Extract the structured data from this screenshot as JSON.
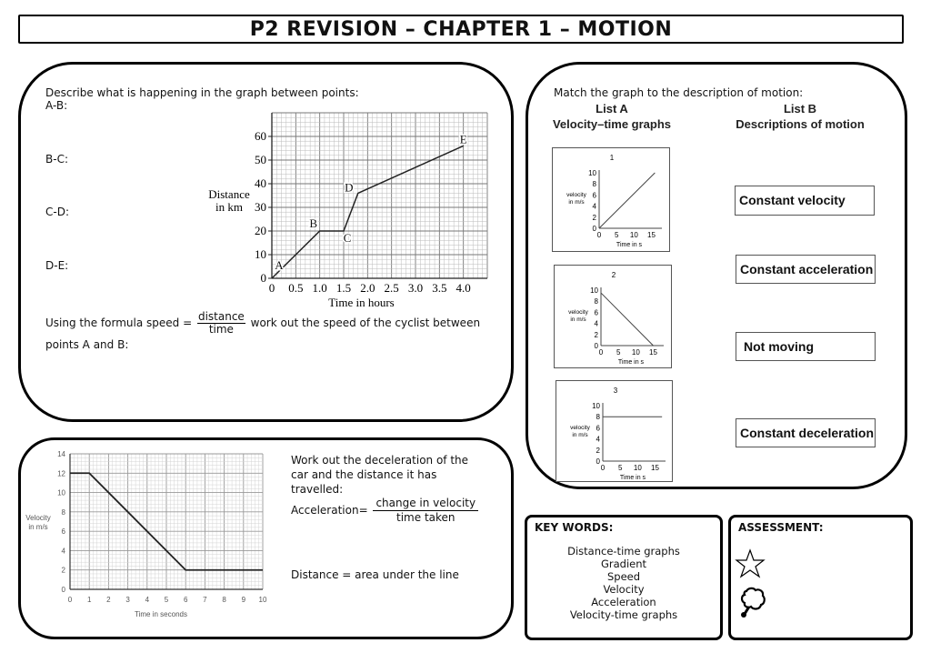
{
  "title": "P2 REVISION – CHAPTER 1 – MOTION",
  "distance_time_panel": {
    "prompt": "Describe what is happening in the graph between points:",
    "segments": [
      "A-B:",
      "B-C:",
      "C-D:",
      "D-E:"
    ],
    "formula_prefix": "Using the formula speed =",
    "formula_numerator": "distance",
    "formula_denominator": "time",
    "formula_suffix": "work out the speed of the cyclist between",
    "formula_line2": "points A and B:"
  },
  "match_panel": {
    "prompt": "Match the graph to the description of motion:",
    "list_a_title": "List A",
    "list_a_subtitle": "Velocity–time graphs",
    "list_b_title": "List B",
    "list_b_subtitle": "Descriptions of motion",
    "graphs": [
      {
        "number": "1",
        "ylabel_line1": "velocity",
        "ylabel_line2": "in m/s",
        "xlabel": "Time in s",
        "yticks": [
          "10",
          "8",
          "6",
          "4",
          "2",
          "0"
        ],
        "xticks": [
          "0",
          "5",
          "10",
          "15"
        ],
        "points": [
          [
            0,
            0
          ],
          [
            16,
            10
          ]
        ]
      },
      {
        "number": "2",
        "ylabel_line1": "velocity",
        "ylabel_line2": "in m/s",
        "xlabel": "Time in s",
        "yticks": [
          "10",
          "8",
          "6",
          "4",
          "2",
          "0"
        ],
        "xticks": [
          "0",
          "5",
          "10",
          "15"
        ],
        "points": [
          [
            0,
            9.5
          ],
          [
            15,
            0
          ]
        ]
      },
      {
        "number": "3",
        "ylabel_line1": "velocity",
        "ylabel_line2": "in m/s",
        "xlabel": "Time in s",
        "yticks": [
          "10",
          "8",
          "6",
          "4",
          "2",
          "0"
        ],
        "xticks": [
          "0",
          "5",
          "10",
          "15"
        ],
        "points": [
          [
            0,
            8
          ],
          [
            17,
            8
          ]
        ]
      }
    ],
    "descriptions": [
      "Constant velocity",
      "Constant acceleration",
      "Not moving",
      "Constant deceleration"
    ]
  },
  "deceleration_panel": {
    "prompt_line1": "Work out the deceleration of the",
    "prompt_line2": "car and the distance it has",
    "prompt_line3": "travelled:",
    "accel_label": "Acceleration=",
    "accel_numerator": "change in velocity",
    "accel_denominator": "time taken",
    "distance_note": "Distance = area under the line"
  },
  "key_words": {
    "heading": "KEY WORDS:",
    "items": [
      "Distance-time graphs",
      "Gradient",
      "Speed",
      "Velocity",
      "Acceleration",
      "Velocity-time graphs"
    ]
  },
  "assessment": {
    "heading": "ASSESSMENT:",
    "icons": [
      "star-icon",
      "thought-bubble-icon"
    ]
  },
  "chart_data": [
    {
      "type": "line",
      "title": "",
      "xlabel": "Time in hours",
      "ylabel": "Distance in km",
      "xlim": [
        0,
        4.5
      ],
      "ylim": [
        0,
        70
      ],
      "xticks": [
        "0",
        "0.5",
        "1.0",
        "1.5",
        "2.0",
        "2.5",
        "3.0",
        "3.5",
        "4.0"
      ],
      "yticks": [
        "0",
        "10",
        "20",
        "30",
        "40",
        "50",
        "60"
      ],
      "grid": true,
      "points": [
        {
          "label": "A",
          "x": 0,
          "y": 0
        },
        {
          "label": "B",
          "x": 1.0,
          "y": 20
        },
        {
          "label": "C",
          "x": 1.5,
          "y": 20
        },
        {
          "label": "D",
          "x": 1.8,
          "y": 36
        },
        {
          "label": "E",
          "x": 4.0,
          "y": 56
        }
      ]
    },
    {
      "type": "line",
      "title": "",
      "xlabel": "Time in seconds",
      "ylabel": "Velocity in m/s",
      "xlim": [
        0,
        10
      ],
      "ylim": [
        0,
        14
      ],
      "xticks": [
        "0",
        "1",
        "2",
        "3",
        "4",
        "5",
        "6",
        "7",
        "8",
        "9",
        "10"
      ],
      "yticks": [
        "0",
        "2",
        "4",
        "6",
        "8",
        "10",
        "12",
        "14"
      ],
      "grid": true,
      "x": [
        0,
        1,
        6,
        10
      ],
      "y": [
        12,
        12,
        2,
        2
      ]
    }
  ]
}
